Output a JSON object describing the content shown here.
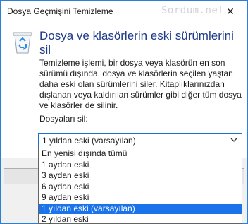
{
  "window": {
    "title": "Dosya Geçmişini Temizleme",
    "watermark": "Sordum.net",
    "close_glyph": "✕"
  },
  "header": {
    "icon": "recycle-bin-icon",
    "heading": "Dosya ve klasörlerin eski sürümlerini sil"
  },
  "body": {
    "description": "Temizleme işlemi, bir dosya veya klasörün en son sürümü dışında, dosya ve klasörlerin seçilen yaştan daha eski olan sürümlerini siler. Kitaplıklarınızdan dışlanan veya kaldırılan sürümler gibi diğer tüm dosya ve klasörler de silinir.",
    "files_label": "Dosyaları sil:"
  },
  "select": {
    "value": "1 yıldan eski (varsayılan)",
    "options": [
      "En yenisi dışında tümü",
      "1 aydan eski",
      "3 aydan eski",
      "6 aydan eski",
      "9 aydan eski",
      "1 yıldan eski (varsayılan)",
      "2 yıldan eski"
    ],
    "selected_index": 5
  },
  "colors": {
    "accent": "#1a73e8",
    "heading": "#1e3a8a",
    "border": "#2b7fd6"
  }
}
